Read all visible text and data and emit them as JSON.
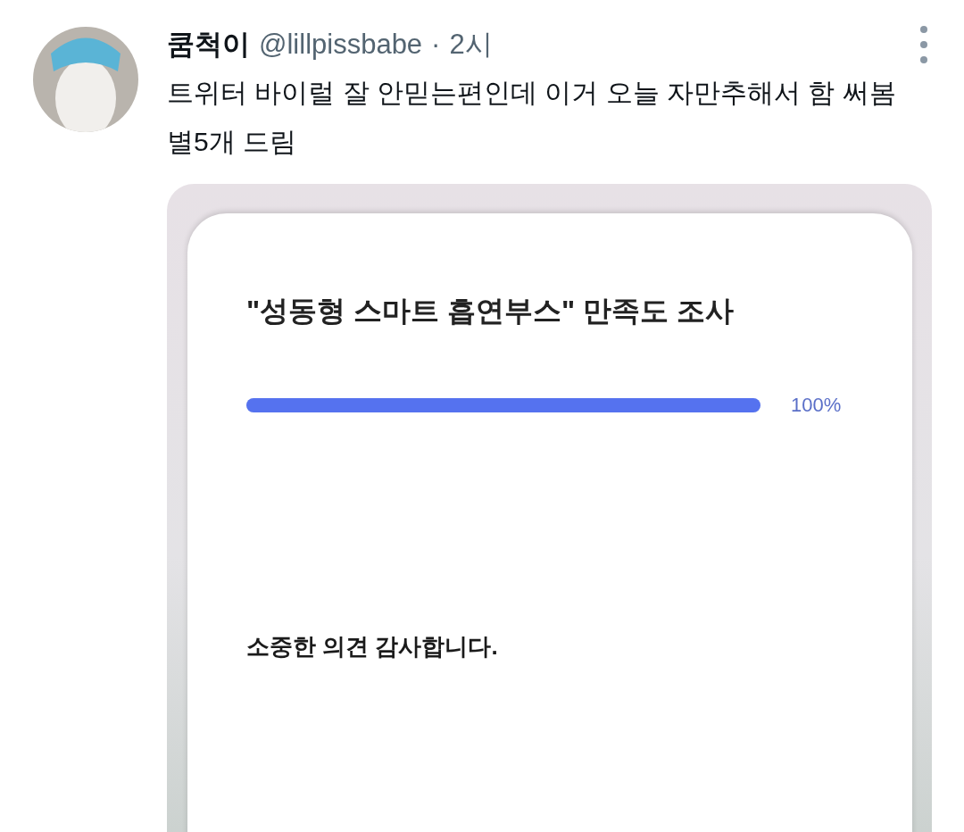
{
  "post": {
    "display_name": "쿰척이",
    "handle": "@lillpissbabe",
    "separator": "·",
    "time": "2시",
    "text": "트위터 바이럴 잘 안믿는편인데 이거 오늘 자만추해서 함 써봄 별5개 드림"
  },
  "image": {
    "title": "\"성동형 스마트 흡연부스\" 만족도 조사",
    "progress": {
      "level": 1,
      "reading": "100%"
    },
    "message": "소중한 의견 감사합니다."
  }
}
